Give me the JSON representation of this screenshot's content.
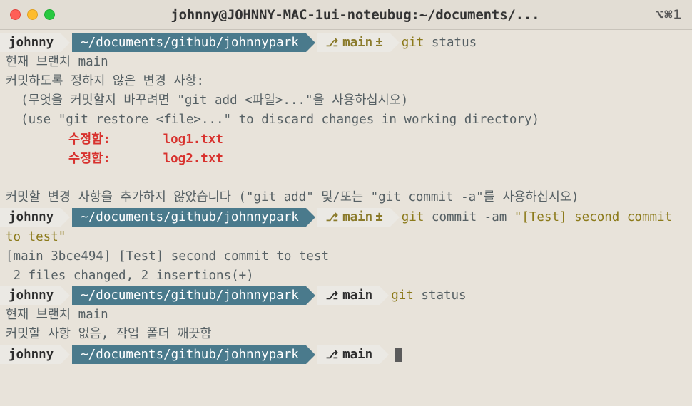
{
  "titlebar": {
    "title": "johnny@JOHNNY-MAC-1ui-noteubug:~/documents/...",
    "shortcut": "⌥⌘1"
  },
  "prompt": {
    "user": "johnny",
    "path": "~/documents/github/johnnypark",
    "branch": "main",
    "dirty_marker": "±"
  },
  "cmd1": {
    "git": "git",
    "rest": "status"
  },
  "status1": {
    "l1": "현재 브랜치 main",
    "l2": "커밋하도록 정하지 않은 변경 사항:",
    "l3": "  (무엇을 커밋할지 바꾸려면 \"git add <파일>...\"을 사용하십시오)",
    "l4": "  (use \"git restore <file>...\" to discard changes in working directory)",
    "mod_label": "수정함:",
    "file1": "log1.txt",
    "file2": "log2.txt",
    "l7": "커밋할 변경 사항을 추가하지 않았습니다 (\"git add\" 및/또는 \"git commit -a\"를 사용하십시오)"
  },
  "cmd2": {
    "git": "git",
    "args": "commit -am",
    "msg": "\"[Test] second commit to test\""
  },
  "commit_out": {
    "l1": "[main 3bce494] [Test] second commit to test",
    "l2": " 2 files changed, 2 insertions(+)"
  },
  "cmd3": {
    "git": "git",
    "rest": "status"
  },
  "status2": {
    "l1": "현재 브랜치 main",
    "l2": "커밋할 사항 없음, 작업 폴더 깨끗함"
  }
}
